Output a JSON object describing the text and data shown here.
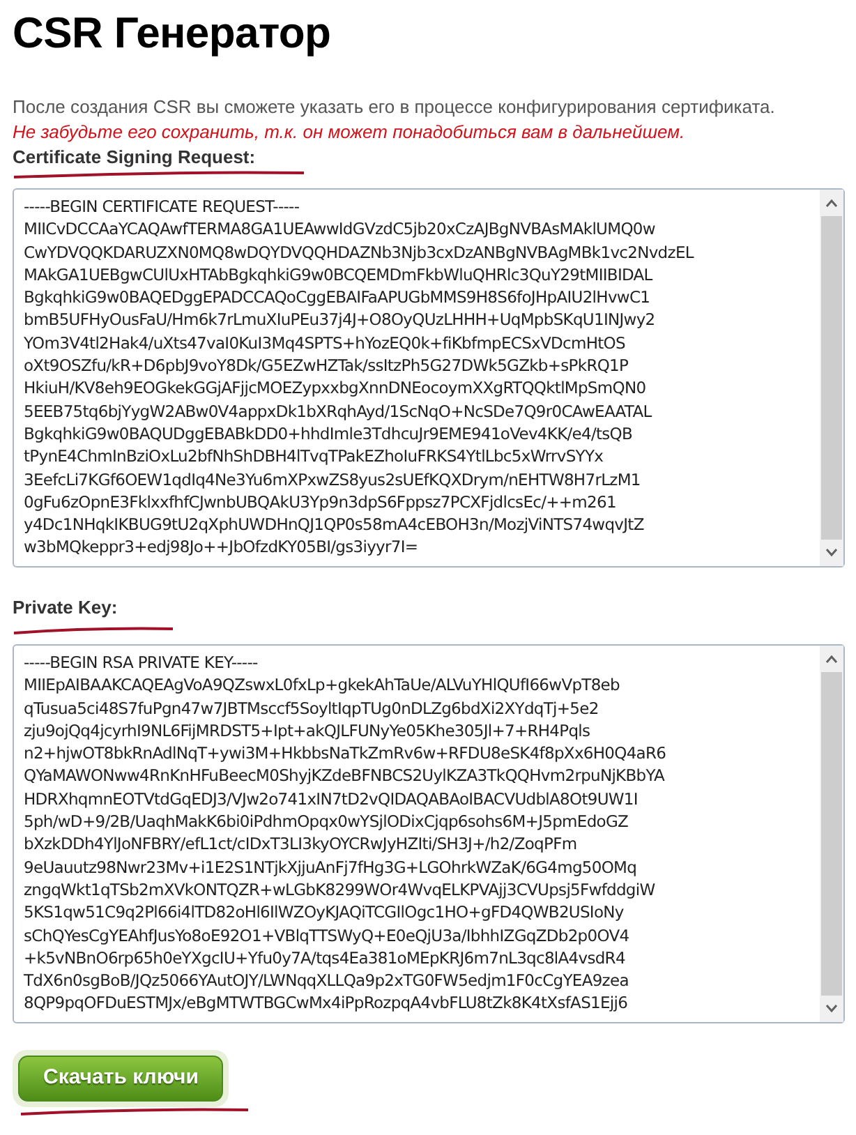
{
  "title": "CSR Генератор",
  "intro": "После создания CSR вы сможете указать его в процессе конфигурирования сертификата.",
  "warning": "Не забудьте его сохранить, т.к. он может понадобиться вам в дальнейшем.",
  "fields": [
    {
      "label": "Certificate Signing Request:",
      "lines": [
        "-----BEGIN CERTIFICATE REQUEST-----",
        "MIICvDCCAaYCAQAwfTERMA8GA1UEAwwIdGVzdC5jb20xCzAJBgNVBAsMAklUMQ0w",
        "CwYDVQQKDARUZXN0MQ8wDQYDVQQHDAZNb3Njb3cxDzANBgNVBAgMBk1vc2NvdzEL",
        "MAkGA1UEBgwCUlUxHTAbBgkqhkiG9w0BCQEMDmFkbWluQHRlc3QuY29tMIIBIDAL",
        "BgkqhkiG9w0BAQEDggEPADCCAQoCggEBAIFaAPUGbMMS9H8S6foJHpAIU2lHvwC1",
        "bmB5UFHyOusFaU/Hm6k7rLmuXIuPEu37j4J+O8OyQUzLHHH+UqMpbSKqU1INJwy2",
        "YOm3V4tl2Hak4/uXts47vaI0KuI3Mq4SPTS+hYozEQ0k+fiKbfmpECSxVDcmHtOS",
        "oXt9OSZfu/kR+D6pbJ9voY8Dk/G5EZwHZTak/ssItzPh5G27DWk5GZkb+sPkRQ1P",
        "HkiuH/KV8eh9EOGkekGGjAFjjcMOEZypxxbgXnnDNEocoymXXgRTQQktlMpSmQN0",
        "5EEB75tq6bjYygW2ABw0V4appxDk1bXRqhAyd/1ScNqO+NcSDe7Q9r0CAwEAATAL",
        "BgkqhkiG9w0BAQUDggEBABkDD0+hhdImle3TdhcuJr9EME941oVev4KK/e4/tsQB",
        "tPynE4ChmInBziOxLu2bfNhShDBH4lTvqTPakEZhoIuFRKS4YtlLbc5xWrrvSYYx",
        "3EefcLi7KGf6OEW1qdIq4Ne3Yu6mXPxwZS8yus2sUEfKQXDrym/nEHTW8H7rLzM1",
        "0gFu6zOpnE3FklxxfhfCJwnbUBQAkU3Yp9n3dpS6Fppsz7PCXFjdlcsEc/++m261",
        "y4Dc1NHqkIKBUG9tU2qXphUWDHnQJ1QP0s58mA4cEBOH3n/MozjViNTS74wqvJtZ",
        "w3bMQkeppr3+edj98Jo++JbOfzdKY05BI/gs3iyyr7I="
      ]
    },
    {
      "label": "Private Key:",
      "lines": [
        "-----BEGIN RSA PRIVATE KEY-----",
        "MIIEpAIBAAKCAQEAgVoA9QZswxL0fxLp+gkekAhTaUe/ALVuYHlQUfI66wVpT8eb",
        "qTusua5ci48S7fuPgn47w7JBTMsccf5SoyltIqpTUg0nDLZg6bdXi2XYdqTj+5e2",
        "zju9ojQq4jcyrhI9NL6FijMRDST5+Ipt+akQJLFUNyYe05Khe305Jl+7+RH4Pqls",
        "n2+hjwOT8bkRnAdlNqT+ywi3M+HkbbsNaTkZmRv6w+RFDU8eSK4f8pXx6H0Q4aR6",
        "QYaMAWONww4RnKnHFuBeecM0ShyjKZdeBFNBCS2UylKZA3TkQQHvm2rpuNjKBbYA",
        "HDRXhqmnEOTVtdGqEDJ3/VJw2o741xIN7tD2vQIDAQABAoIBACVUdblA8Ot9UW1I",
        "5ph/wD+9/2B/UaqhMakK6bi0iPdhmOpqx0wYSjlODixCjqp6sohs6M+J5pmEdoGZ",
        "bXzkDDh4YlJoNFBRY/efL1ct/cIDxT3LI3kyOYCRwJyHZIti/SH3J+/h2/ZoqPFm",
        "9eUauutz98Nwr23Mv+i1E2S1NTjkXjjuAnFj7fHg3G+LGOhrkWZaK/6G4mg50OMq",
        "zngqWkt1qTSb2mXVkONTQZR+wLGbK8299WOr4WvqELKPVAjj3CVUpsj5FwfddgiW",
        "5KS1qw51C9q2Pl66i4lTD82oHl6IlWZOyKJAQiTCGIlOgc1HO+gFD4QWB2USIoNy",
        "sChQYesCgYEAhfJusYo8oE92O1+VBlqTTSWyQ+E0eQjU3a/IbhhIZGqZDb2p0OV4",
        "+k5vNBnO6rp65h0eYXgcIU+Yfu0y7A/tqs4Ea381oMEpKRJ6m7nL3qc8lA4vsdR4",
        "TdX6n0sgBoB/JQz5066YAutOJY/LWNqqXLLQa9p2xTG0FW5edjm1F0cCgYEA9zea",
        "8QP9pqOFDuESTMJx/eBgMTWTBGCwMx4iPpRozpqA4vbFLU8tZk8K4tXsfAS1Ejj6"
      ]
    }
  ],
  "download_button": "Скачать ключи"
}
